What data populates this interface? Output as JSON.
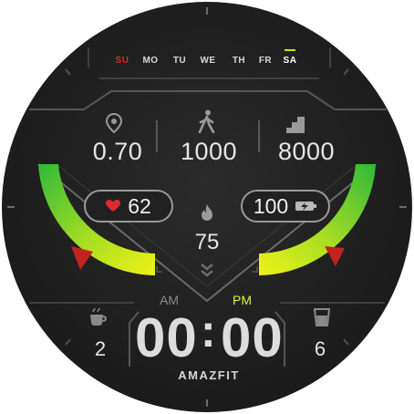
{
  "weekdays": {
    "items": [
      "SU",
      "MO",
      "TU",
      "WE",
      "TH",
      "FR",
      "SA"
    ],
    "current": "SA"
  },
  "stats": {
    "distance": "0.70",
    "steps": "1000",
    "floors": "8000"
  },
  "heart_rate": "62",
  "calories": "75",
  "battery": "100",
  "time": {
    "hours": "00",
    "separator": ":",
    "minutes": "00",
    "am": "AM",
    "pm": "PM",
    "active_period": "PM"
  },
  "water": "2",
  "weather_value": "6",
  "brand": "AMAZFIT",
  "colors": {
    "accent": "#bfe51f",
    "arc_green": "#3fc43a",
    "arc_yellow": "#e3f218",
    "pointer_red": "#c4231f",
    "sunday_red": "#e0282e",
    "pm_yellow": "#dff23a"
  },
  "icons": [
    "location-pin-icon",
    "walking-person-icon",
    "stairs-icon",
    "heart-icon",
    "flame-icon",
    "battery-charging-icon",
    "double-chevron-down-icon",
    "coffee-cup-icon",
    "water-glass-icon"
  ]
}
